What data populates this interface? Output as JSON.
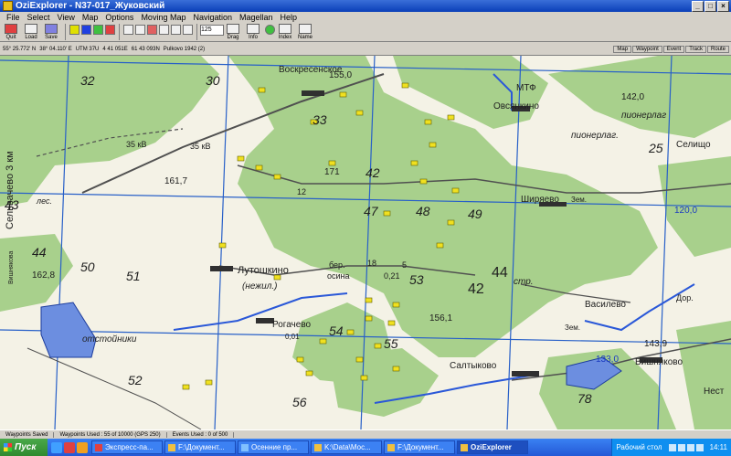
{
  "window": {
    "title": "OziExplorer - N37-017_Жуковский",
    "min": "_",
    "max": "□",
    "close": "×"
  },
  "menu": [
    "File",
    "Select",
    "View",
    "Map",
    "Options",
    "Moving Map",
    "Navigation",
    "Magellan",
    "Help"
  ],
  "toolbar": {
    "quit": "Quit",
    "load": "Load",
    "save": "Save",
    "zoom": "125",
    "drag": "Drag",
    "info": "Info",
    "index": "Index",
    "name": "Name"
  },
  "coords": {
    "lat": "55° 25.772' N",
    "lon": "38° 04.110' E",
    "utm": "UTM 37U",
    "e": "4 41 051E",
    "n": "61 43 093N",
    "datum": "Pulkovo 1942 (2)"
  },
  "coord_buttons": [
    "Map",
    "Waypoint",
    "Event",
    "Track",
    "Route"
  ],
  "status": {
    "saved": "Waypoints Saved",
    "wp_used": "Waypoints Used : 55 of 10000  (GPS 250)",
    "ev_used": "Events Used : 0 of 500"
  },
  "map": {
    "labels": [
      "32",
      "30",
      "Воскресенское",
      "Сельвачево 3 км",
      "155,0",
      "33",
      "МТФ",
      "Овсянкино",
      "142,0",
      "пионерлаг.",
      "пионерлаг",
      "35 кВ",
      "35 кВ",
      "171",
      "161,7",
      "42",
      "12",
      "25",
      "Селищо",
      "47",
      "48",
      "49",
      "Ширяево",
      "Зем.",
      "120,0",
      "Вишнякова",
      "44",
      "43",
      "50",
      "162,8",
      "лес.",
      "Лутошкино",
      "(нежил.)",
      "бер.",
      "осина",
      "18",
      "0,21",
      "5",
      "53",
      "44",
      "42",
      "стр.",
      "51",
      "54",
      "Рогачево",
      "0,01",
      "156,1",
      "Василево",
      "Зем.",
      "Дор.",
      "отстойники",
      "55",
      "143,9",
      "133,0",
      "Вишняково",
      "52",
      "56",
      "Салтыково",
      "78",
      "Нест"
    ]
  },
  "taskbar": {
    "start": "Пуск",
    "tasks": [
      "Экспресс-па...",
      "F:\\Документ...",
      "Осенние пр...",
      "K:\\Data\\Мос...",
      "F:\\Документ...",
      "OziExplorer"
    ],
    "lang": "Рабочий стол",
    "clock": "14:11"
  },
  "colors": {
    "forest": "#a8d08c",
    "grid": "#2860c8",
    "road": "#505050",
    "water": "#2a58d8"
  }
}
